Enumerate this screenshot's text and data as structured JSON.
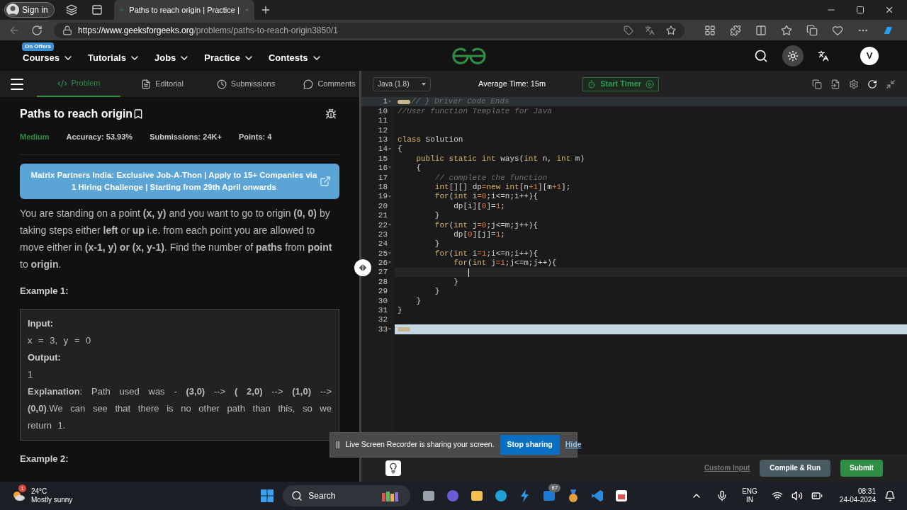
{
  "browser": {
    "sign_in": "Sign in",
    "tab_title": "Paths to reach origin | Practice |",
    "url_host": "https://www.geeksforgeeks.org",
    "url_path": "/problems/paths-to-reach-origin3850/1"
  },
  "site_nav": {
    "badge": "On Offers",
    "items": [
      "Courses",
      "Tutorials",
      "Jobs",
      "Practice",
      "Contests"
    ],
    "avatar": "V"
  },
  "problem_tabs": [
    {
      "label": "Problem",
      "selected": true
    },
    {
      "label": "Editorial",
      "selected": false
    },
    {
      "label": "Submissions",
      "selected": false
    },
    {
      "label": "Comments",
      "selected": false
    }
  ],
  "problem": {
    "title": "Paths to reach origin",
    "difficulty": "Medium",
    "accuracy": "Accuracy: 53.93%",
    "submissions": "Submissions: 24K+",
    "points": "Points: 4",
    "banner": "Matrix Partners India: Exclusive Job-A-Thon | Apply to 15+ Companies via 1 Hiring Challenge | Starting from 29th April onwards",
    "description": "You are standing on a point **(x, y)** and you want to go to origin **(0, 0)** by taking steps either **left** or **up** i.e. from each point you are allowed to move either in **(x-1, y) or (x, y-1)**. Find the number of **paths** from **point** to **origin**.",
    "examples": [
      {
        "heading": "Example 1:",
        "lines": [
          {
            "kind": "label",
            "text": "Input:"
          },
          {
            "kind": "value",
            "text": "x = 3, y = 0"
          },
          {
            "kind": "label",
            "text": "Output:"
          },
          {
            "kind": "value",
            "text": "1"
          },
          {
            "kind": "value",
            "text": "**Explanation**: Path used was -  **(3,0)**  --> **( 2,0)** --> **(1,0)** --> **(0,0)**.We can see that there is no other path than this, so we return  1."
          }
        ]
      },
      {
        "heading": "Example 2:"
      }
    ]
  },
  "editor": {
    "language": "Java (1.8)",
    "average_time": "Average Time: 15m",
    "start_timer": "Start Timer",
    "lines": [
      {
        "number": "1",
        "foldable": true,
        "folded": true,
        "highlighted": true,
        "selected": false,
        "current": false,
        "segments": [
          {
            "text": "// } Driver Code Ends",
            "kind": "comment"
          }
        ]
      },
      {
        "number": "10",
        "foldable": false,
        "folded": false,
        "highlighted": false,
        "selected": false,
        "current": false,
        "segments": [
          {
            "text": "//User function Template for Java",
            "kind": "comment"
          }
        ]
      },
      {
        "number": "11",
        "foldable": false,
        "folded": false,
        "highlighted": false,
        "selected": false,
        "current": false
      },
      {
        "number": "12",
        "foldable": false,
        "folded": false,
        "highlighted": false,
        "selected": false,
        "current": false
      },
      {
        "number": "13",
        "foldable": false,
        "folded": false,
        "highlighted": false,
        "selected": false,
        "current": false,
        "segments": [
          {
            "text": "class",
            "kind": "keyword"
          },
          {
            "text": " Solution",
            "kind": "plain"
          }
        ]
      },
      {
        "number": "14",
        "foldable": true,
        "folded": false,
        "highlighted": false,
        "selected": false,
        "current": false,
        "segments": [
          {
            "text": "{",
            "kind": "plain"
          }
        ]
      },
      {
        "number": "15",
        "foldable": false,
        "folded": false,
        "highlighted": false,
        "selected": false,
        "current": false,
        "segments": [
          {
            "text": "    public static int",
            "kind": "keyword"
          },
          {
            "text": " ways(",
            "kind": "plain"
          },
          {
            "text": "int",
            "kind": "keyword"
          },
          {
            "text": " n, ",
            "kind": "plain"
          },
          {
            "text": "int",
            "kind": "keyword"
          },
          {
            "text": " m)",
            "kind": "plain"
          }
        ]
      },
      {
        "number": "16",
        "foldable": true,
        "folded": false,
        "highlighted": false,
        "selected": false,
        "current": false,
        "segments": [
          {
            "text": "    {",
            "kind": "plain"
          }
        ]
      },
      {
        "number": "17",
        "foldable": false,
        "folded": false,
        "highlighted": false,
        "selected": false,
        "current": false,
        "segments": [
          {
            "text": "        // complete the function",
            "kind": "comment"
          }
        ]
      },
      {
        "number": "18",
        "foldable": false,
        "folded": false,
        "highlighted": false,
        "selected": false,
        "current": false,
        "segments": [
          {
            "text": "        int",
            "kind": "keyword"
          },
          {
            "text": "[][] dp",
            "kind": "plain"
          },
          {
            "text": "=",
            "kind": "number"
          },
          {
            "text": "new int",
            "kind": "keyword"
          },
          {
            "text": "[n",
            "kind": "plain"
          },
          {
            "text": "+1",
            "kind": "number"
          },
          {
            "text": "][m",
            "kind": "plain"
          },
          {
            "text": "+1",
            "kind": "number"
          },
          {
            "text": "];",
            "kind": "plain"
          }
        ]
      },
      {
        "number": "19",
        "foldable": true,
        "folded": false,
        "highlighted": false,
        "selected": false,
        "current": false,
        "segments": [
          {
            "text": "        for",
            "kind": "keyword"
          },
          {
            "text": "(",
            "kind": "plain"
          },
          {
            "text": "int",
            "kind": "keyword"
          },
          {
            "text": " i",
            "kind": "plain"
          },
          {
            "text": "=0",
            "kind": "number"
          },
          {
            "text": ";i<=n;i++){",
            "kind": "plain"
          }
        ]
      },
      {
        "number": "20",
        "foldable": false,
        "folded": false,
        "highlighted": false,
        "selected": false,
        "current": false,
        "segments": [
          {
            "text": "            dp[i][",
            "kind": "plain"
          },
          {
            "text": "0",
            "kind": "number"
          },
          {
            "text": "]=",
            "kind": "plain"
          },
          {
            "text": "1",
            "kind": "number"
          },
          {
            "text": ";",
            "kind": "plain"
          }
        ]
      },
      {
        "number": "21",
        "foldable": false,
        "folded": false,
        "highlighted": false,
        "selected": false,
        "current": false,
        "segments": [
          {
            "text": "        }",
            "kind": "plain"
          }
        ]
      },
      {
        "number": "22",
        "foldable": true,
        "folded": false,
        "highlighted": false,
        "selected": false,
        "current": false,
        "segments": [
          {
            "text": "        for",
            "kind": "keyword"
          },
          {
            "text": "(",
            "kind": "plain"
          },
          {
            "text": "int",
            "kind": "keyword"
          },
          {
            "text": " j",
            "kind": "plain"
          },
          {
            "text": "=0",
            "kind": "number"
          },
          {
            "text": ";j<=m;j++){",
            "kind": "plain"
          }
        ]
      },
      {
        "number": "23",
        "foldable": false,
        "folded": false,
        "highlighted": false,
        "selected": false,
        "current": false,
        "segments": [
          {
            "text": "            dp[",
            "kind": "plain"
          },
          {
            "text": "0",
            "kind": "number"
          },
          {
            "text": "][j]=",
            "kind": "plain"
          },
          {
            "text": "1",
            "kind": "number"
          },
          {
            "text": ";",
            "kind": "plain"
          }
        ]
      },
      {
        "number": "24",
        "foldable": false,
        "folded": false,
        "highlighted": false,
        "selected": false,
        "current": false,
        "segments": [
          {
            "text": "        }",
            "kind": "plain"
          }
        ]
      },
      {
        "number": "25",
        "foldable": true,
        "folded": false,
        "highlighted": false,
        "selected": false,
        "current": false,
        "segments": [
          {
            "text": "        for",
            "kind": "keyword"
          },
          {
            "text": "(",
            "kind": "plain"
          },
          {
            "text": "int",
            "kind": "keyword"
          },
          {
            "text": " i",
            "kind": "plain"
          },
          {
            "text": "=1",
            "kind": "number"
          },
          {
            "text": ";i<=n;i++){",
            "kind": "plain"
          }
        ]
      },
      {
        "number": "26",
        "foldable": true,
        "folded": false,
        "highlighted": false,
        "selected": false,
        "current": false,
        "segments": [
          {
            "text": "            for",
            "kind": "keyword"
          },
          {
            "text": "(",
            "kind": "plain"
          },
          {
            "text": "int",
            "kind": "keyword"
          },
          {
            "text": " j",
            "kind": "plain"
          },
          {
            "text": "=1",
            "kind": "number"
          },
          {
            "text": ";j<=m;j++){",
            "kind": "plain"
          }
        ]
      },
      {
        "number": "27",
        "foldable": false,
        "folded": false,
        "highlighted": false,
        "selected": false,
        "current": true
      },
      {
        "number": "28",
        "foldable": false,
        "folded": false,
        "highlighted": false,
        "selected": false,
        "current": false,
        "segments": [
          {
            "text": "            }",
            "kind": "plain"
          }
        ]
      },
      {
        "number": "29",
        "foldable": false,
        "folded": false,
        "highlighted": false,
        "selected": false,
        "current": false,
        "segments": [
          {
            "text": "        }",
            "kind": "plain"
          }
        ]
      },
      {
        "number": "30",
        "foldable": false,
        "folded": false,
        "highlighted": false,
        "selected": false,
        "current": false,
        "segments": [
          {
            "text": "    }",
            "kind": "plain"
          }
        ]
      },
      {
        "number": "31",
        "foldable": false,
        "folded": false,
        "highlighted": false,
        "selected": false,
        "current": false,
        "segments": [
          {
            "text": "}",
            "kind": "plain"
          }
        ]
      },
      {
        "number": "32",
        "foldable": false,
        "folded": false,
        "highlighted": false,
        "selected": false,
        "current": false
      },
      {
        "number": "33",
        "foldable": true,
        "folded": true,
        "highlighted": false,
        "selected": true,
        "current": false
      }
    ],
    "custom_input": "Custom Input",
    "compile_run": "Compile & Run",
    "submit": "Submit"
  },
  "share_bar": {
    "pause": "||",
    "message": "Live Screen Recorder is sharing your screen.",
    "stop": "Stop sharing",
    "hide": "Hide"
  },
  "taskbar": {
    "notification_count": "1",
    "temperature": "24°C",
    "weather": "Mostly sunny",
    "search": "Search",
    "app_badge": "87",
    "language": "ENG",
    "region": "IN",
    "time": "08:31",
    "date": "24-04-2024"
  }
}
